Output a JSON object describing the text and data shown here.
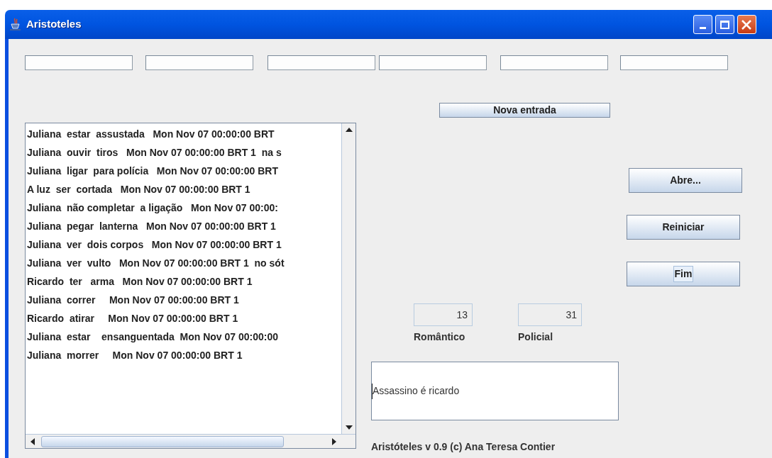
{
  "window": {
    "title": "Aristoteles"
  },
  "list": {
    "items": [
      "Juliana  estar  assustada   Mon Nov 07 00:00:00 BRT",
      "Juliana  ouvir  tiros   Mon Nov 07 00:00:00 BRT 1  na s",
      "Juliana  ligar  para polícia   Mon Nov 07 00:00:00 BRT",
      "A luz  ser  cortada   Mon Nov 07 00:00:00 BRT 1",
      "Juliana  não completar  a ligação   Mon Nov 07 00:00:",
      "Juliana  pegar  lanterna   Mon Nov 07 00:00:00 BRT 1",
      "Juliana  ver  dois corpos   Mon Nov 07 00:00:00 BRT 1",
      "Juliana  ver  vulto   Mon Nov 07 00:00:00 BRT 1  no sót",
      "Ricardo  ter   arma   Mon Nov 07 00:00:00 BRT 1",
      "Juliana  correr     Mon Nov 07 00:00:00 BRT 1",
      "Ricardo  atirar     Mon Nov 07 00:00:00 BRT 1",
      "Juliana  estar    ensanguentada  Mon Nov 07 00:00:00",
      "Juliana  morrer     Mon Nov 07 00:00:00 BRT 1"
    ]
  },
  "new_entry_button": "Nova entrada",
  "side_buttons": [
    {
      "label": "Abre...",
      "focused": false
    },
    {
      "label": "Reiniciar",
      "focused": false
    },
    {
      "label": "Fim",
      "focused": true
    }
  ],
  "scores": [
    {
      "value": "13",
      "label": "Romântico"
    },
    {
      "value": "31",
      "label": "Policial"
    }
  ],
  "text_area": {
    "value": "Assassino é ricardo"
  },
  "footer": "Aristóteles v 0.9 (c) Ana Teresa Contier"
}
